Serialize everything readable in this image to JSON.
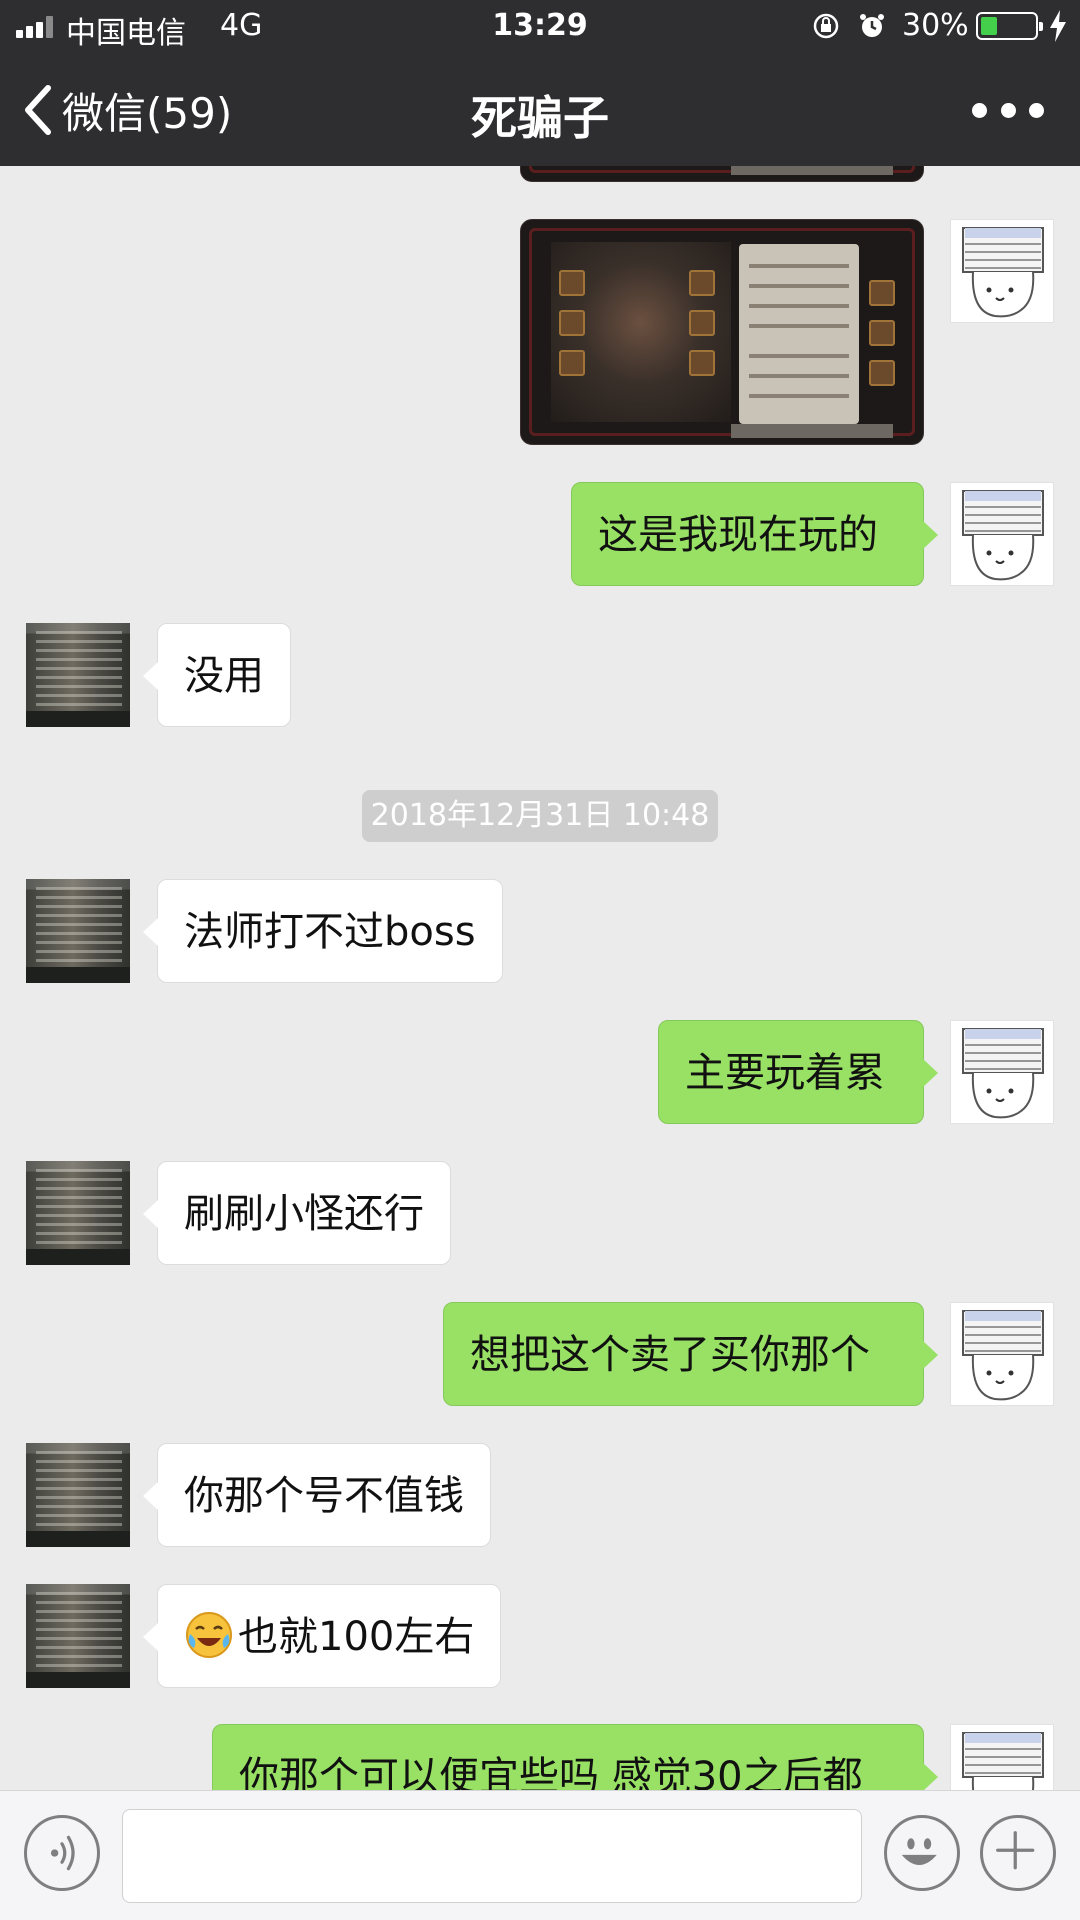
{
  "status_bar": {
    "carrier": "中国电信",
    "network": "4G",
    "time": "13:29",
    "battery_percent_label": "30%",
    "battery_level": 0.3
  },
  "nav": {
    "back_label": "微信(59)",
    "title": "死骗子"
  },
  "messages": [
    {
      "side": "me",
      "type": "image",
      "desc": "game-screenshot-partial"
    },
    {
      "side": "me",
      "type": "image",
      "desc": "game-screenshot"
    },
    {
      "side": "me",
      "type": "text",
      "text": "这是我现在玩的"
    },
    {
      "side": "them",
      "type": "text",
      "text": "没用"
    },
    {
      "type": "timestamp",
      "text": "2018年12月31日 10:48"
    },
    {
      "side": "them",
      "type": "text",
      "text": "法师打不过boss"
    },
    {
      "side": "me",
      "type": "text",
      "text": "主要玩着累"
    },
    {
      "side": "them",
      "type": "text",
      "text": "刷刷小怪还行"
    },
    {
      "side": "me",
      "type": "text",
      "text": "想把这个卖了买你那个"
    },
    {
      "side": "them",
      "type": "text",
      "text": "你那个号不值钱"
    },
    {
      "side": "them",
      "type": "text",
      "emoji": "crying-laughing",
      "text": "也就100左右"
    },
    {
      "side": "me",
      "type": "text",
      "text": "你那个可以便宜些吗 感觉30之后都"
    }
  ],
  "colors": {
    "header_bg": "#2e2e30",
    "chat_bg": "#ebebeb",
    "my_bubble": "#98e165",
    "their_bubble": "#ffffff",
    "battery_green": "#45d04b"
  },
  "input_bar": {
    "placeholder": "",
    "icons": [
      "voice-icon",
      "emoji-icon",
      "plus-icon"
    ]
  }
}
